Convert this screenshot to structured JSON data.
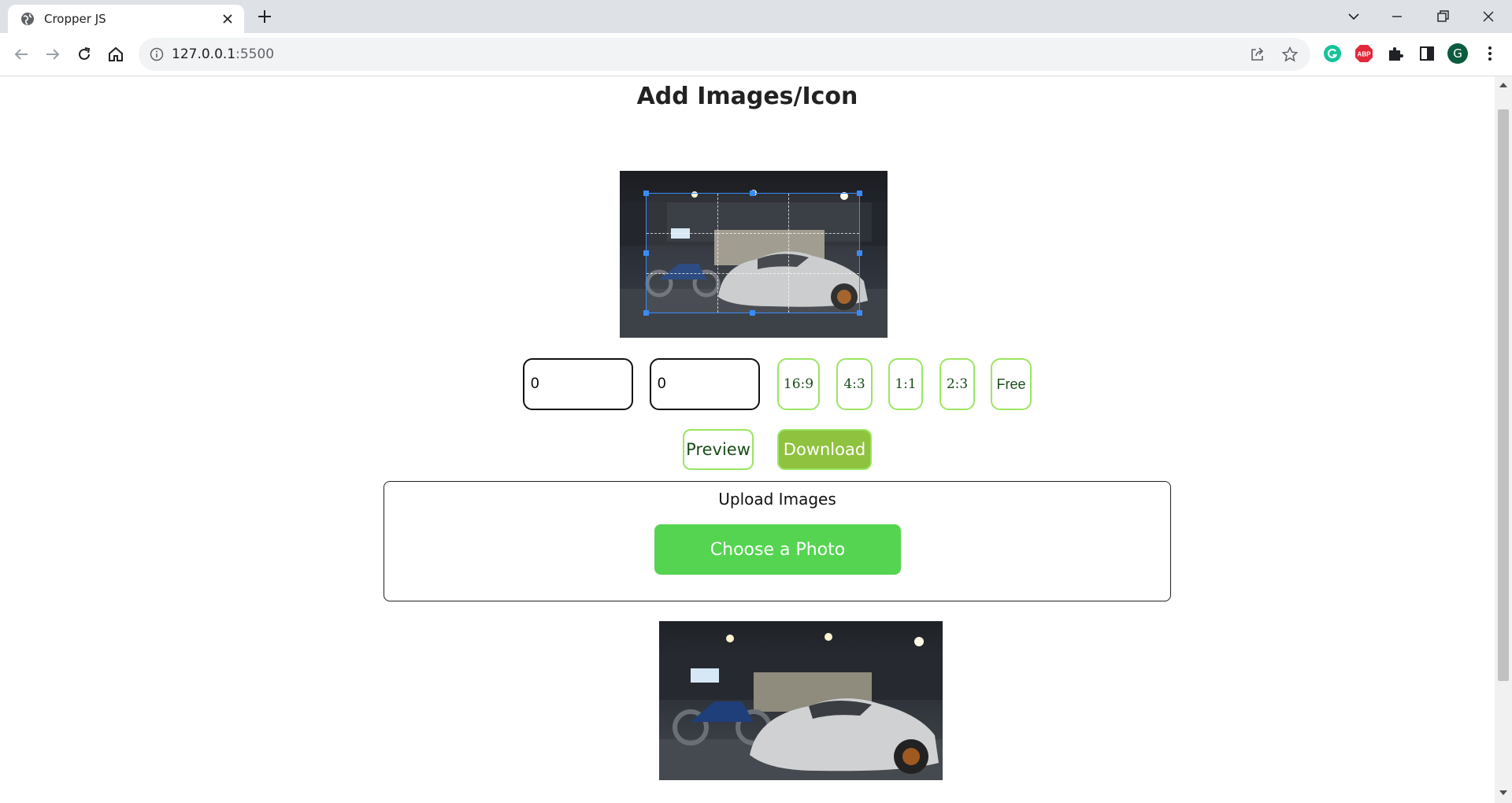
{
  "browser": {
    "tab_title": "Cropper JS",
    "url_host": "127.0.0.1",
    "url_port": ":5500",
    "profile_initial": "G",
    "extensions": [
      "grammarly-icon",
      "adblock-plus-icon",
      "puzzle-icon",
      "sidepanel-icon"
    ]
  },
  "page": {
    "title": "Add Images/Icon"
  },
  "controls": {
    "width_value": "0",
    "height_value": "0",
    "ratios": [
      "16:9",
      "4:3",
      "1:1",
      "2:3",
      "Free"
    ],
    "preview_label": "Preview",
    "download_label": "Download"
  },
  "upload": {
    "label": "Upload Images",
    "choose_label": "Choose a Photo"
  },
  "colors": {
    "accent_green": "#9be562",
    "download_bg": "#8fc23f",
    "choose_bg": "#55d451",
    "crop_handle": "#3b8bf7"
  }
}
